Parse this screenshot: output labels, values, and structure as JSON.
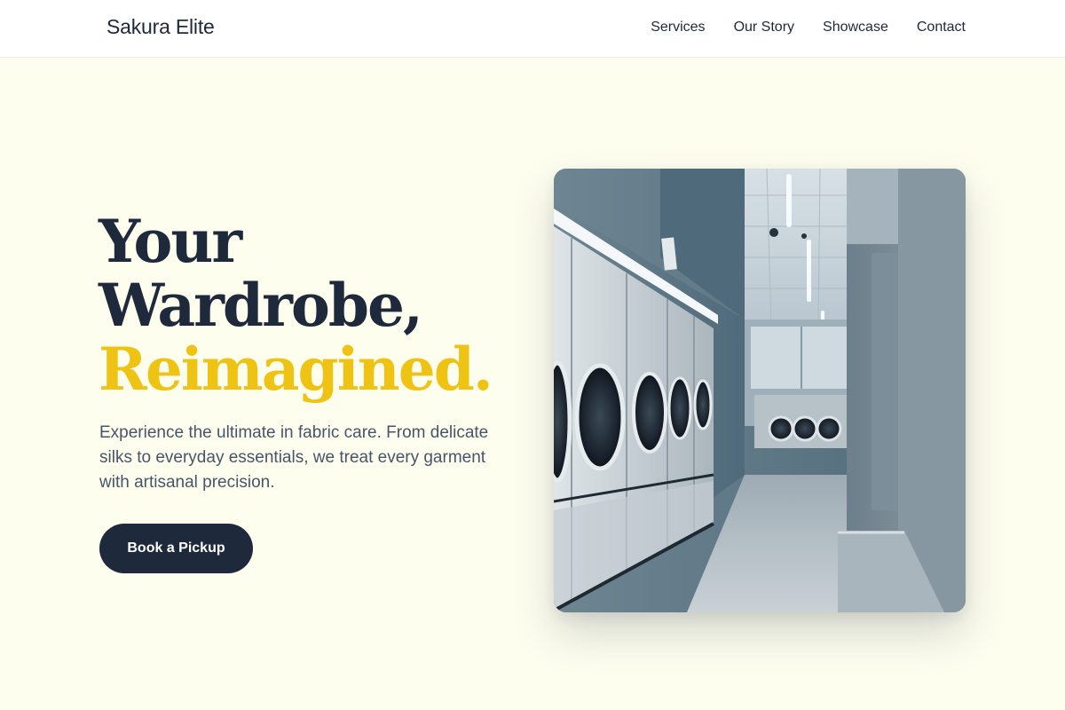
{
  "header": {
    "brand": "Sakura Elite",
    "nav": [
      "Services",
      "Our Story",
      "Showcase",
      "Contact"
    ]
  },
  "hero": {
    "title_lines": [
      "Your",
      "Wardrobe,"
    ],
    "title_accent": "Reimagined.",
    "description": "Experience the ultimate in fabric care. From delicate silks to everyday essentials, we treat every garment with artisanal precision.",
    "cta_label": "Book a Pickup",
    "image": {
      "description": "laundromat-interior-photo"
    }
  },
  "colors": {
    "background": "#fefeef",
    "navy": "#1e293b",
    "accent": "#eec314",
    "body_text": "#475569"
  }
}
